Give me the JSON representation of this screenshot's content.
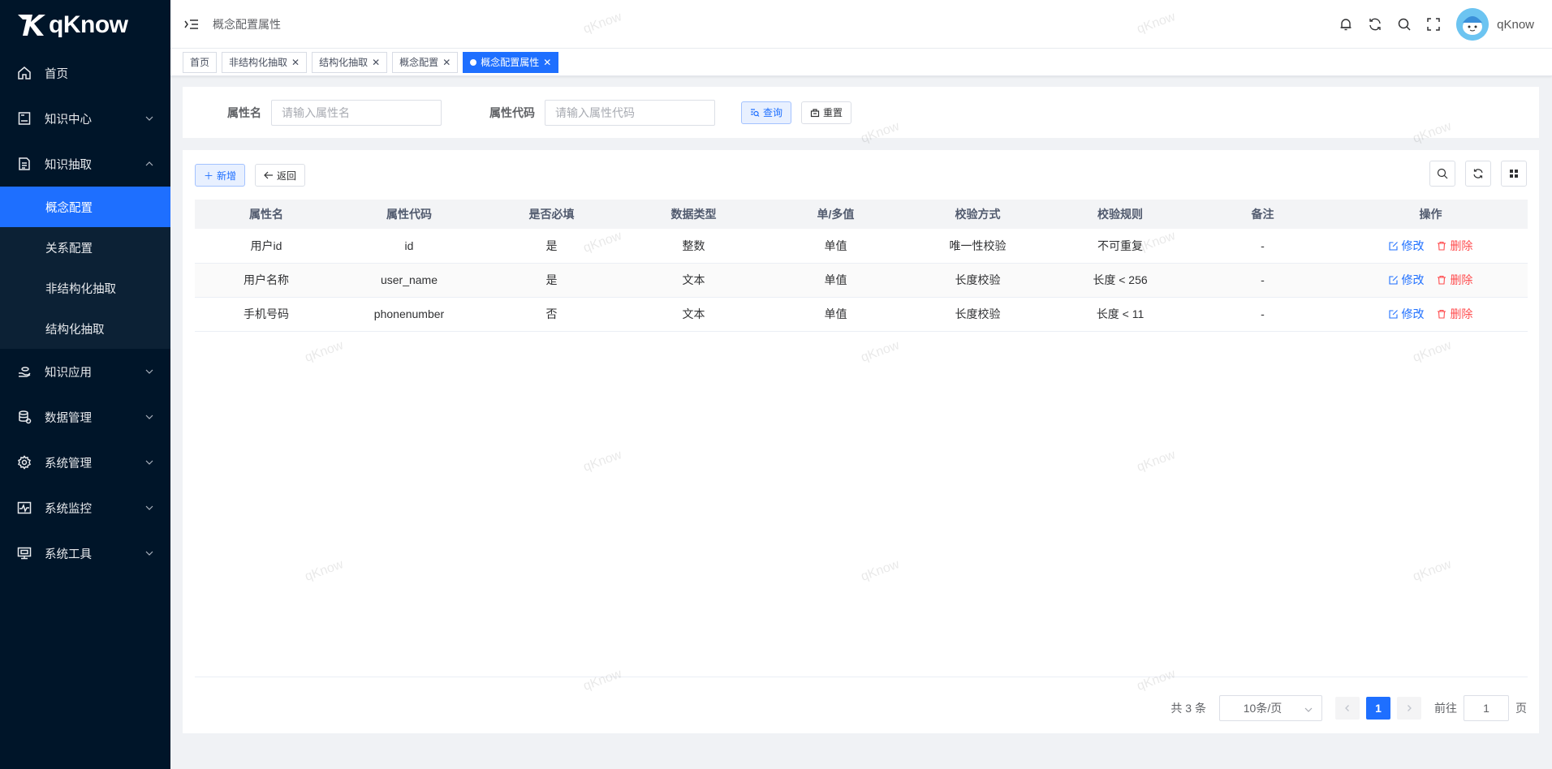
{
  "app": {
    "name": "qKnow"
  },
  "sidebar": {
    "items": [
      {
        "label": "首页",
        "icon": "home-icon",
        "expanded": false,
        "has_children": false
      },
      {
        "label": "知识中心",
        "icon": "book-icon",
        "expanded": false,
        "has_children": true
      },
      {
        "label": "知识抽取",
        "icon": "document-icon",
        "expanded": true,
        "has_children": true,
        "children": [
          {
            "label": "概念配置",
            "active": true
          },
          {
            "label": "关系配置",
            "active": false
          },
          {
            "label": "非结构化抽取",
            "active": false
          },
          {
            "label": "结构化抽取",
            "active": false
          }
        ]
      },
      {
        "label": "知识应用",
        "icon": "hand-icon",
        "expanded": false,
        "has_children": true
      },
      {
        "label": "数据管理",
        "icon": "database-icon",
        "expanded": false,
        "has_children": true
      },
      {
        "label": "系统管理",
        "icon": "gear-icon",
        "expanded": false,
        "has_children": true
      },
      {
        "label": "系统监控",
        "icon": "monitor-chart-icon",
        "expanded": false,
        "has_children": true
      },
      {
        "label": "系统工具",
        "icon": "tool-monitor-icon",
        "expanded": false,
        "has_children": true
      }
    ]
  },
  "header": {
    "breadcrumb": "概念配置属性",
    "username": "qKnow"
  },
  "tags": [
    {
      "label": "首页",
      "closable": false,
      "active": false
    },
    {
      "label": "非结构化抽取",
      "closable": true,
      "active": false
    },
    {
      "label": "结构化抽取",
      "closable": true,
      "active": false
    },
    {
      "label": "概念配置",
      "closable": true,
      "active": false
    },
    {
      "label": "概念配置属性",
      "closable": true,
      "active": true
    }
  ],
  "search": {
    "name_label": "属性名",
    "name_placeholder": "请输入属性名",
    "code_label": "属性代码",
    "code_placeholder": "请输入属性代码",
    "query_label": "查询",
    "reset_label": "重置"
  },
  "toolbar": {
    "add_label": "新增",
    "back_label": "返回"
  },
  "table": {
    "columns": [
      "属性名",
      "属性代码",
      "是否必填",
      "数据类型",
      "单/多值",
      "校验方式",
      "校验规则",
      "备注",
      "操作"
    ],
    "rows": [
      {
        "name": "用户id",
        "code": "id",
        "required": "是",
        "type": "整数",
        "multi": "单值",
        "check": "唯一性校验",
        "rule": "不可重复",
        "remark": "-"
      },
      {
        "name": "用户名称",
        "code": "user_name",
        "required": "是",
        "type": "文本",
        "multi": "单值",
        "check": "长度校验",
        "rule": "长度 < 256",
        "remark": "-"
      },
      {
        "name": "手机号码",
        "code": "phonenumber",
        "required": "否",
        "type": "文本",
        "multi": "单值",
        "check": "长度校验",
        "rule": "长度 < 11",
        "remark": "-"
      }
    ],
    "edit_label": "修改",
    "delete_label": "删除"
  },
  "pagination": {
    "total_text": "共 3 条",
    "page_size": "10条/页",
    "current_page": "1",
    "goto_prefix": "前往",
    "goto_value": "1",
    "goto_suffix": "页"
  },
  "colors": {
    "primary": "#1e6fff",
    "sidebar_bg": "#001529",
    "danger": "#ff4d4f"
  }
}
